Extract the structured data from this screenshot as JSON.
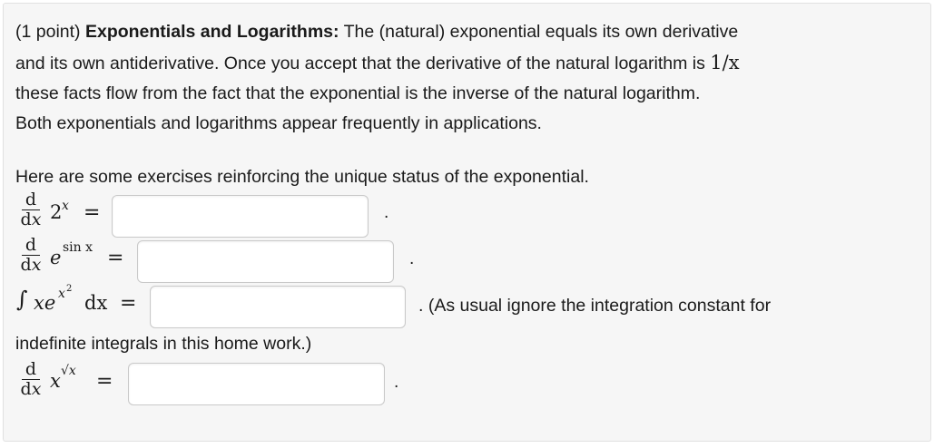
{
  "intro": {
    "points": "(1 point)",
    "topic": "Exponentials and Logarithms:",
    "line1_rest": " The (natural) exponential equals its own derivative",
    "line2": "and its own antiderivative. Once you accept that the derivative of the natural logarithm is ",
    "line2_math": "1/x",
    "line3": "these facts flow from the fact that the exponential is the inverse of the natural logarithm.",
    "line4": "Both exponentials and logarithms appear frequently in applications."
  },
  "exercises_intro": "Here are some exercises reinforcing the unique status of the exponential.",
  "math": {
    "d": "d",
    "dx_d": "d",
    "dx_x": "x",
    "equals": "=",
    "q1_base": "2",
    "q1_exp": "x",
    "q2_base": "e",
    "q2_exp": "sin x",
    "q3_integrand_x": "xe",
    "q3_exp": "x",
    "q3_exp_pow": "2",
    "q3_dx": "dx",
    "q4_base": "x",
    "q4_exp": "√x"
  },
  "answers": {
    "q1": "",
    "q2": "",
    "q3": "",
    "q4": ""
  },
  "period": ".",
  "note_part1": ". (As usual ignore the integration constant for",
  "note_part2": "indefinite integrals in this home work.)"
}
